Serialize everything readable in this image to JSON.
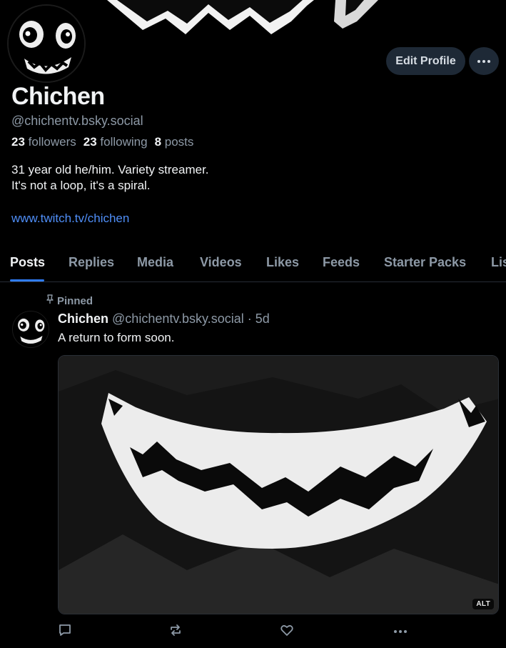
{
  "profile": {
    "display_name": "Chichen",
    "handle": "@chichentv.bsky.social",
    "followers_count": "23",
    "followers_label": "followers",
    "following_count": "23",
    "following_label": "following",
    "posts_count": "8",
    "posts_label": "posts",
    "bio_line1": "31 year old he/him. Variety streamer.",
    "bio_line2": "It's not a loop, it's a spiral.",
    "link": "www.twitch.tv/chichen"
  },
  "header": {
    "edit_label": "Edit Profile"
  },
  "tabs": [
    {
      "label": "Posts",
      "active": true
    },
    {
      "label": "Replies"
    },
    {
      "label": "Media"
    },
    {
      "label": "Videos"
    },
    {
      "label": "Likes"
    },
    {
      "label": "Feeds"
    },
    {
      "label": "Starter Packs"
    },
    {
      "label": "Lis"
    }
  ],
  "post": {
    "pinned_label": "Pinned",
    "author_name": "Chichen",
    "author_handle": "@chichentv.bsky.social",
    "separator": "·",
    "age": "5d",
    "text": "A return to form soon.",
    "alt_badge": "ALT"
  },
  "icons": {
    "pinned": "pin-icon",
    "reply": "speech-bubble-icon",
    "repost": "repost-icon",
    "like": "heart-icon",
    "more": "ellipsis-icon"
  },
  "colors": {
    "background": "#000000",
    "accent": "#2f7cf6",
    "link": "#4f8ef7",
    "muted": "#8d99a6",
    "button_bg": "#1e2936"
  }
}
